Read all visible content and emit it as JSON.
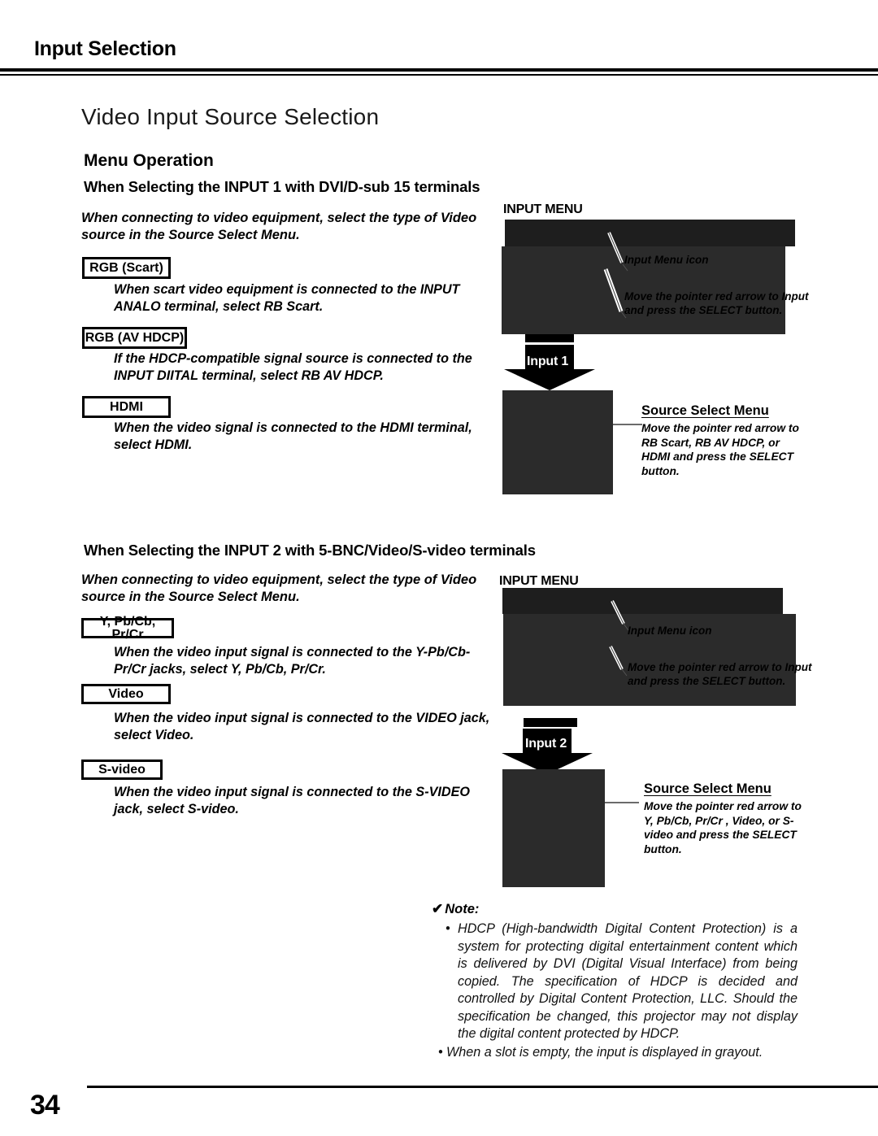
{
  "header": {
    "running_title": "Input Selection"
  },
  "page_title": "Video Input Source Selection",
  "menu_operation_heading": "Menu Operation",
  "sections": [
    {
      "heading": "When Selecting the INPUT 1 with DVI/D-sub 15 terminals",
      "intro": "When connecting to video equipment, select the type of Video source in the Source Select Menu.",
      "items": [
        {
          "chip": "RGB (Scart)",
          "body": "When scart video equipment is connected to the INPUT ANALO terminal, select RB Scart."
        },
        {
          "chip": "RGB (AV HDCP)",
          "body": "If the HDCP-compatible signal source is connected to the INPUT  DIITAL terminal, select RB AV HDCP."
        },
        {
          "chip": "HDMI",
          "body": "When the video signal is connected to the HDMI terminal, select HDMI."
        }
      ],
      "figure": {
        "menu_label": "INPUT MENU",
        "callout_icon": "Input Menu icon",
        "callout_move": "Move the pointer red arrow to Input and press the SELECT button.",
        "arrow_label": "Input 1",
        "source_title": "Source Select Menu",
        "source_body": "Move the pointer red arrow to RB Scart, RB AV HDCP, or HDMI and press the SELECT button."
      }
    },
    {
      "heading": "When Selecting the INPUT 2 with 5-BNC/Video/S-video terminals",
      "intro": "When connecting to video equipment, select the type of Video source in the Source Select Menu.",
      "items": [
        {
          "chip": "Y, Pb/Cb, Pr/Cr",
          "body": "When the video input signal is connected to the Y-Pb/Cb-Pr/Cr jacks, select Y, Pb/Cb, Pr/Cr."
        },
        {
          "chip": "Video",
          "body": "When the video input signal is connected to the VIDEO jack, select Video."
        },
        {
          "chip": "S-video",
          "body": "When the video input signal is connected to the S-VIDEO jack, select S-video."
        }
      ],
      "figure": {
        "menu_label": "INPUT MENU",
        "callout_icon": "Input Menu icon",
        "callout_move": "Move the pointer red arrow to Input and press the SELECT button.",
        "arrow_label": "Input 2",
        "source_title": "Source Select Menu",
        "source_body": "Move the pointer red arrow to Y, Pb/Cb, Pr/Cr , Video, or S-video and press the SELECT button."
      }
    }
  ],
  "note": {
    "heading": "Note:",
    "check_glyph": "✔",
    "bullet_glyph": "•",
    "items": [
      "HDCP (High-bandwidth Digital Content Protection) is a system for protecting digital entertainment content which is delivered by DVI (Digital Visual Interface) from being copied. The specification of HDCP is decided and controlled by Digital Content Protection, LLC. Should the specification be changed, this projector may not display the digital content protected by HDCP.",
      "When a slot is empty, the input is displayed in grayout."
    ]
  },
  "footer": {
    "page_number": "34"
  },
  "colors": {
    "screen_body": "#2b2b2b",
    "screen_topbar": "#1e1e1e",
    "ink": "#000000"
  }
}
